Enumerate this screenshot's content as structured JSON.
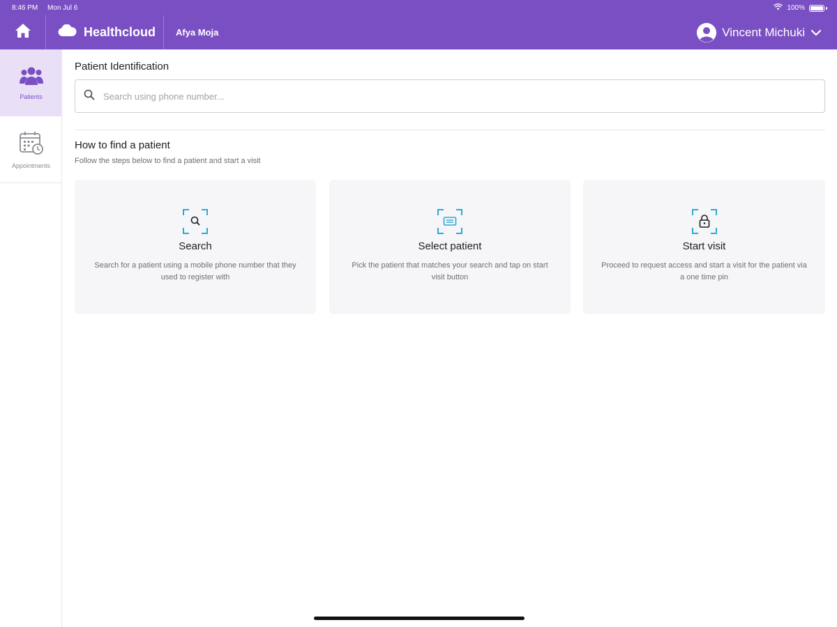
{
  "status_bar": {
    "time": "8:46 PM",
    "date": "Mon Jul 6",
    "battery": "100%"
  },
  "app_bar": {
    "brand": "Healthcloud",
    "organization": "Afya Moja",
    "user_name": "Vincent Michuki"
  },
  "sidenav": {
    "items": [
      {
        "label": "Patients",
        "icon": "patients-icon",
        "active": true
      },
      {
        "label": "Appointments",
        "icon": "calendar-clock-icon",
        "active": false
      }
    ]
  },
  "main": {
    "section_title": "Patient Identification",
    "search": {
      "value": "",
      "placeholder": "Search using phone number..."
    },
    "how_to": {
      "title": "How to find a patient",
      "subtitle": "Follow the steps below to find a patient and start a visit",
      "steps": [
        {
          "title": "Search",
          "description": "Search for a patient using a mobile phone number that they used to register with",
          "icon": "scan-search-icon"
        },
        {
          "title": "Select patient",
          "description": "Pick the patient that matches your search and tap on start visit button",
          "icon": "scan-card-icon"
        },
        {
          "title": "Start visit",
          "description": "Proceed to request access and start a visit for the patient via a one time pin",
          "icon": "scan-lock-icon"
        }
      ]
    }
  },
  "colors": {
    "brand_purple": "#7a4fc3",
    "active_nav_bg": "#e9e0f7",
    "icon_accent": "#29a9d6",
    "card_bg": "#f6f6f8"
  }
}
